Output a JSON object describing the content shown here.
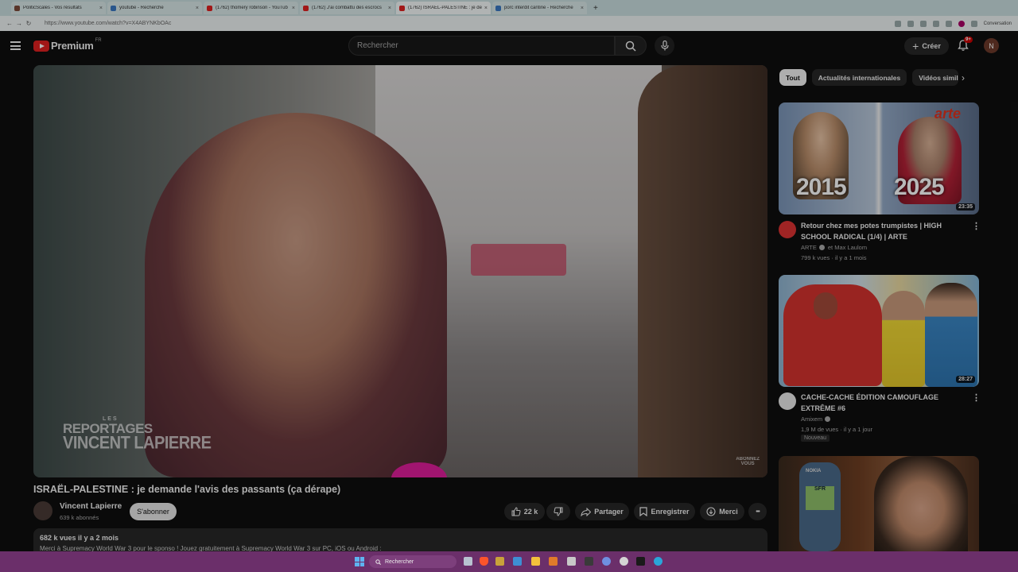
{
  "browser": {
    "tabs": [
      {
        "title": "PoliticScales - Vos résultats",
        "color": "#7c4a3a",
        "active": false
      },
      {
        "title": "youtube - Recherche",
        "color": "#3a78c2",
        "active": false
      },
      {
        "title": "(1762) thomery robinson - YouTub",
        "color": "#e02020",
        "active": false
      },
      {
        "title": "(1762) J'ai combattu des escrocs",
        "color": "#e02020",
        "active": false
      },
      {
        "title": "(1762) ISRAËL-PALESTINE : je dem",
        "color": "#e02020",
        "active": true
      },
      {
        "title": "porc interdit cantine - Recherche",
        "color": "#3a78c2",
        "active": false
      }
    ],
    "close_glyph": "×",
    "new_tab_glyph": "+",
    "url": "https://www.youtube.com/watch?v=X4ABYNKbOAc",
    "conversation_label": "Conversation"
  },
  "header": {
    "logo_text": "Premium",
    "logo_region": "FR",
    "search_placeholder": "Rechercher",
    "create_label": "Créer",
    "create_glyph": "+",
    "notifications_badge": "9+",
    "avatar_letter": "N"
  },
  "video": {
    "title": "ISRAËL-PALESTINE : je demande l'avis des passants (ça dérape)",
    "watermark": [
      "LES",
      "REPORTAGES",
      "VINCENT LAPIERRE"
    ],
    "corner_watermark": [
      "ABONNEZ",
      "VOUS"
    ],
    "channel_name": "Vincent Lapierre",
    "channel_subs": "639 k abonnés",
    "subscribe_label": "S'abonner",
    "likes": "22 k",
    "share_label": "Partager",
    "save_label": "Enregistrer",
    "thanks_label": "Merci",
    "more_glyph": "•••",
    "views_date": "682 k vues  il y a 2 mois",
    "description_line": "Merci à Supremacy World War 3 pour le sponso ! Jouez gratuitement à Supremacy World War 3 sur PC, iOS ou Android :"
  },
  "sidebar": {
    "chips": [
      "Tout",
      "Actualités internationales",
      "Vidéos simil"
    ],
    "chevron_glyph": "›",
    "kebab_glyph": "⋮",
    "recommendations": [
      {
        "title": "Retour chez mes potes trumpistes | HIGH SCHOOL RADICAL (1/4) | ARTE",
        "channel": "ARTE",
        "channel_extra": "et Max Laulom",
        "meta": "799 k vues · il y a 1 mois",
        "duration": "23:35",
        "thumb_text_left": "2015",
        "thumb_text_right": "2025",
        "thumb_brand": "arte"
      },
      {
        "title": "CACHE-CACHE ÉDITION CAMOUFLAGE EXTRÊME #6",
        "channel": "Amixem",
        "meta": "1,9 M de vues · il y a 1 jour",
        "badge": "Nouveau",
        "duration": "28:27"
      },
      {
        "thumb_phone_text": "SFR",
        "thumb_brand": "NOKIA"
      }
    ]
  },
  "taskbar": {
    "search_placeholder": "Rechercher"
  }
}
